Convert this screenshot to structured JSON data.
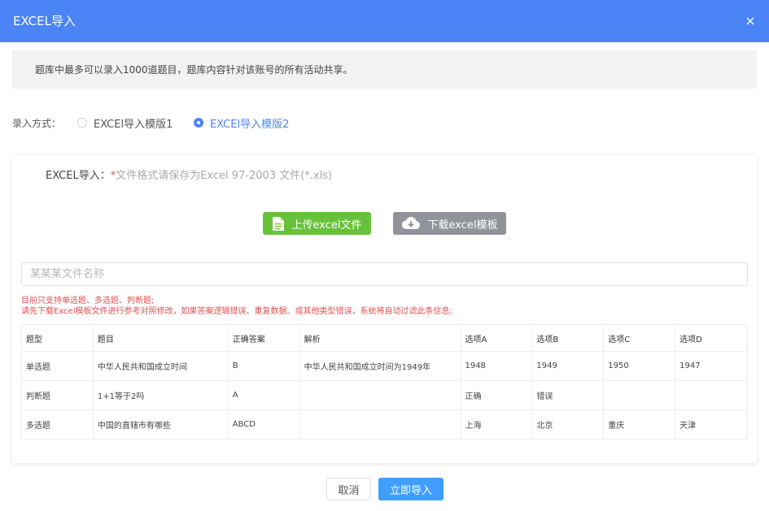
{
  "dialog": {
    "title": "EXCEL导入",
    "close_icon": "×"
  },
  "notice": {
    "text": "题库中最多可以录入1000道题目，题库内容针对该账号的所有活动共享。"
  },
  "mode": {
    "label": "录入方式：",
    "options": [
      {
        "label": "EXCEl导入模版1",
        "selected": false
      },
      {
        "label": "EXCEl导入模版2",
        "selected": true
      }
    ]
  },
  "excel": {
    "label": "EXCEL导入：",
    "required_mark": "*",
    "hint": "文件格式请保存为Excel 97-2003 文件(*.xls)",
    "upload_button": "上传excel文件",
    "download_button": "下载excel模板",
    "file_placeholder": "某某某文件名称",
    "warning_line1": "目前只支持单选题、多选题、判断题;",
    "warning_line2": "请先下载Excel模板文件进行参考对照修改，如果答案逻辑错误、重复数据、或其他类型错误，系统将自动过滤此条信息;"
  },
  "table": {
    "headers": [
      "题型",
      "题目",
      "正确答案",
      "解析",
      "选项A",
      "选项B",
      "选项C",
      "选项D"
    ],
    "rows": [
      [
        "单选题",
        "中华人民共和国成立时间",
        "B",
        "中华人民共和国成立时间为1949年",
        "1948",
        "1949",
        "1950",
        "1947"
      ],
      [
        "判断题",
        "1+1等于2吗",
        "A",
        "",
        "正确",
        "错误",
        "",
        ""
      ],
      [
        "多选题",
        "中国的直辖市有哪些",
        "ABCD",
        "",
        "上海",
        "北京",
        "重庆",
        "天津"
      ]
    ]
  },
  "footer": {
    "cancel_button": "取消",
    "confirm_button": "立即导入"
  },
  "colors": {
    "header": "#4b84f7",
    "upload": "#67c23a",
    "download": "#909399",
    "primary": "#409eff",
    "warning": "#e05050"
  },
  "icons": {
    "upload": "file-icon",
    "download": "cloud-download-icon",
    "close": "close-icon"
  }
}
